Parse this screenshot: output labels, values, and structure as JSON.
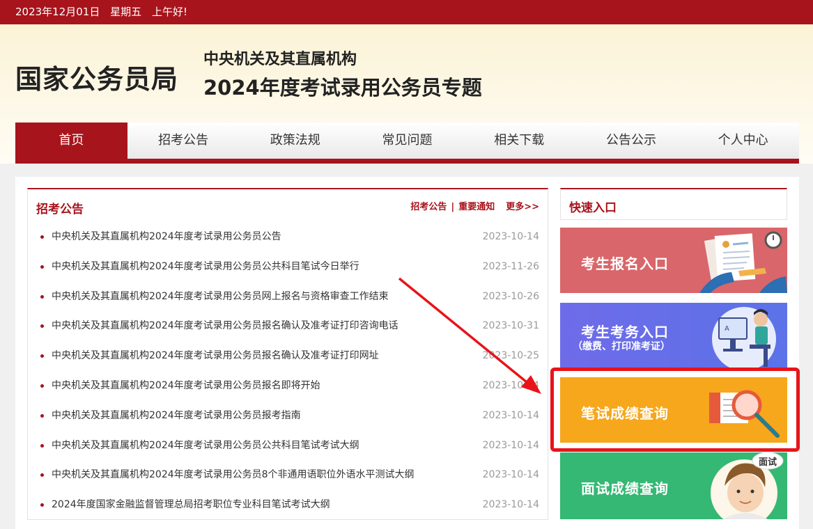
{
  "topbar": {
    "date": "2023年12月01日",
    "weekday": "星期五",
    "greeting": "上午好!"
  },
  "header": {
    "logo": "国家公务员局",
    "subtitle1": "中央机关及其直属机构",
    "subtitle2": "2024年度考试录用公务员专题"
  },
  "nav": {
    "items": [
      {
        "label": "首页"
      },
      {
        "label": "招考公告"
      },
      {
        "label": "政策法规"
      },
      {
        "label": "常见问题"
      },
      {
        "label": "相关下载"
      },
      {
        "label": "公告公示"
      },
      {
        "label": "个人中心"
      }
    ]
  },
  "notices": {
    "title": "招考公告",
    "link1": "招考公告",
    "separator": "|",
    "link2": "重要通知",
    "more": "更多>>",
    "items": [
      {
        "title": "中央机关及其直属机构2024年度考试录用公务员公告",
        "date": "2023-10-14"
      },
      {
        "title": "中央机关及其直属机构2024年度考试录用公务员公共科目笔试今日举行",
        "date": "2023-11-26"
      },
      {
        "title": "中央机关及其直属机构2024年度考试录用公务员网上报名与资格审查工作结束",
        "date": "2023-10-26"
      },
      {
        "title": "中央机关及其直属机构2024年度考试录用公务员报名确认及准考证打印咨询电话",
        "date": "2023-10-31"
      },
      {
        "title": "中央机关及其直属机构2024年度考试录用公务员报名确认及准考证打印网址",
        "date": "2023-10-25"
      },
      {
        "title": "中央机关及其直属机构2024年度考试录用公务员报名即将开始",
        "date": "2023-10-14"
      },
      {
        "title": "中央机关及其直属机构2024年度考试录用公务员报考指南",
        "date": "2023-10-14"
      },
      {
        "title": "中央机关及其直属机构2024年度考试录用公务员公共科目笔试考试大纲",
        "date": "2023-10-14"
      },
      {
        "title": "中央机关及其直属机构2024年度考试录用公务员8个非通用语职位外语水平测试大纲",
        "date": "2023-10-14"
      },
      {
        "title": "2024年度国家金融监督管理总局招考职位专业科目笔试考试大纲",
        "date": "2023-10-14"
      }
    ]
  },
  "quick": {
    "title": "快速入口",
    "register": "考生报名入口",
    "exam": "考生考务入口",
    "exam_sub": "（缴费、打印准考证）",
    "written": "笔试成绩查询",
    "interview": "面试成绩查询",
    "interview_badge": "面试"
  },
  "colors": {
    "brand_red": "#a8141c",
    "highlight_red": "#e8131a",
    "register_card": "#d9666a",
    "exam_card": "#6f6be9",
    "written_card": "#f6a71b",
    "interview_card": "#34b873"
  }
}
